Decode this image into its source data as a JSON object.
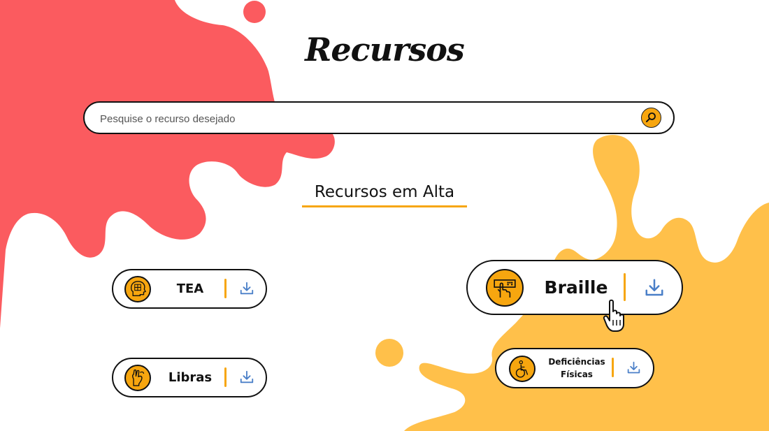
{
  "page": {
    "title": "Recursos"
  },
  "search": {
    "placeholder": "Pesquise o recurso desejado"
  },
  "section": {
    "title": "Recursos em Alta"
  },
  "resources": {
    "tea": {
      "label": "TEA",
      "icon": "puzzle-head-icon"
    },
    "libras": {
      "label": "Libras",
      "icon": "sign-hand-icon"
    },
    "braille": {
      "label": "Braille",
      "icon": "braille-touch-icon"
    },
    "fisicas": {
      "label_line1": "Deficiências",
      "label_line2": "Físicas",
      "icon": "wheelchair-icon"
    }
  },
  "colors": {
    "red_splash": "#fb5b5f",
    "yellow_splash": "#ffc04a",
    "accent": "#f7a60f",
    "download": "#4a7fc8"
  }
}
